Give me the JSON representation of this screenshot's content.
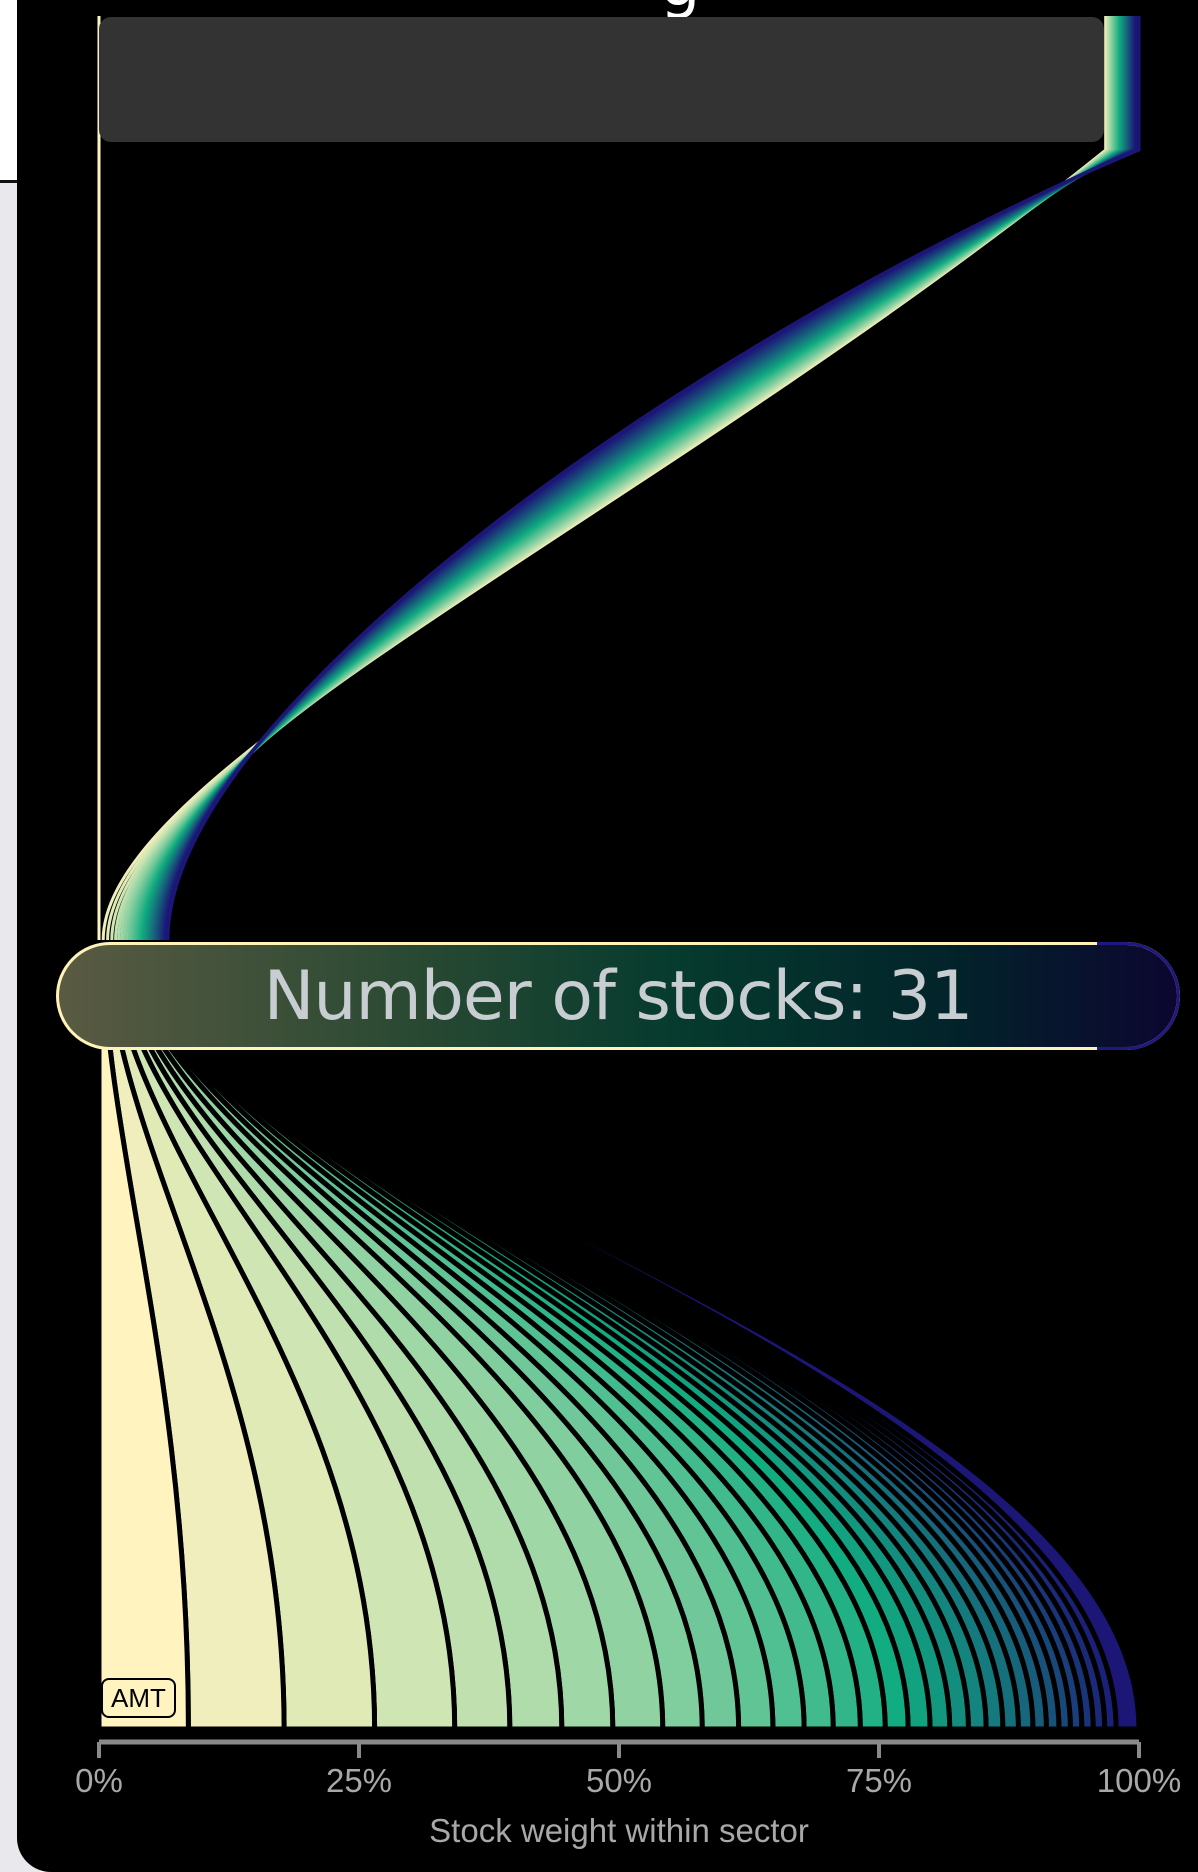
{
  "header": {
    "title_fragment": "g"
  },
  "search": {
    "value": ""
  },
  "chart_data": {
    "type": "area",
    "n_stocks": 31,
    "count_label": "Number of stocks: 31",
    "highlighted_stock": "AMT",
    "xlabel": "Stock weight within sector",
    "x_ticks": [
      "0%",
      "25%",
      "50%",
      "75%",
      "100%"
    ],
    "xlim": [
      0,
      100
    ],
    "bottom_boundaries_pct": [
      8.6,
      17.8,
      26.5,
      34.2,
      39.5,
      44.5,
      49.4,
      54.2,
      58.0,
      61.5,
      64.8,
      67.8,
      70.6,
      73.2,
      75.6,
      77.8,
      79.9,
      81.8,
      83.6,
      85.3,
      86.9,
      88.4,
      89.8,
      91.1,
      92.3,
      93.4,
      94.5,
      95.6,
      96.7,
      97.8
    ],
    "top_boundaries_pct": [
      96.8,
      96.9,
      97.0,
      97.1,
      97.2,
      97.3,
      97.4,
      97.5,
      97.6,
      97.7,
      97.8,
      97.9,
      98.0,
      98.1,
      98.2,
      98.3,
      98.4,
      98.5,
      98.6,
      98.7,
      98.8,
      98.9,
      99.0,
      99.1,
      99.2,
      99.3,
      99.4,
      99.5,
      99.6,
      99.7
    ],
    "colors": {
      "start": "#fff3c0",
      "mid": "#11ac80",
      "end": "#1c1677"
    }
  }
}
